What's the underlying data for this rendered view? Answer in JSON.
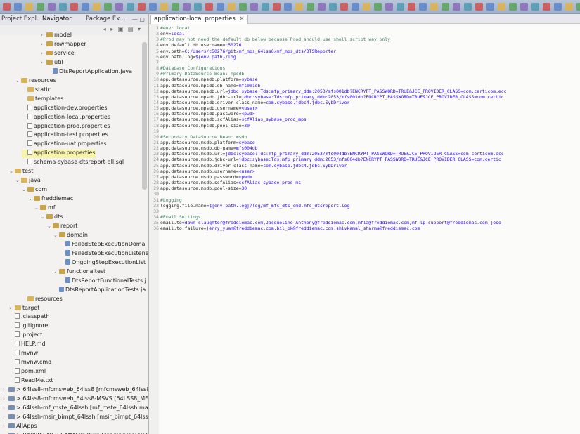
{
  "left_view": {
    "tabs": [
      "Project Expl...",
      "Navigator",
      "Package Ex..."
    ],
    "tree": [
      {
        "label": "model",
        "indent": 6,
        "kind": "pkg",
        "twisty": ">",
        "selected": false
      },
      {
        "label": "rowmapper",
        "indent": 6,
        "kind": "pkg",
        "twisty": ">",
        "selected": false
      },
      {
        "label": "service",
        "indent": 6,
        "kind": "pkg",
        "twisty": ">",
        "selected": false
      },
      {
        "label": "util",
        "indent": 6,
        "kind": "pkg",
        "twisty": ">",
        "selected": false
      },
      {
        "label": "DtsReportApplication.java",
        "indent": 7,
        "kind": "java",
        "twisty": "",
        "selected": false
      },
      {
        "label": "resources",
        "indent": 2,
        "kind": "folder",
        "twisty": "v",
        "selected": false
      },
      {
        "label": "static",
        "indent": 3,
        "kind": "folder",
        "twisty": "",
        "selected": false
      },
      {
        "label": "templates",
        "indent": 3,
        "kind": "folder",
        "twisty": "",
        "selected": false
      },
      {
        "label": "application-dev.properties",
        "indent": 3,
        "kind": "file",
        "twisty": "",
        "selected": false
      },
      {
        "label": "application-local.properties",
        "indent": 3,
        "kind": "file",
        "twisty": "",
        "selected": false
      },
      {
        "label": "application-prod.properties",
        "indent": 3,
        "kind": "file",
        "twisty": "",
        "selected": false
      },
      {
        "label": "application-test.properties",
        "indent": 3,
        "kind": "file",
        "twisty": "",
        "selected": false
      },
      {
        "label": "application-uat.properties",
        "indent": 3,
        "kind": "file",
        "twisty": "",
        "selected": false
      },
      {
        "label": "application.properties",
        "indent": 3,
        "kind": "file",
        "twisty": "",
        "selected": true
      },
      {
        "label": "schema-sybase-dtsreport-all.sql",
        "indent": 3,
        "kind": "file",
        "twisty": "",
        "selected": false
      },
      {
        "label": "test",
        "indent": 1,
        "kind": "folder",
        "twisty": "v",
        "selected": false
      },
      {
        "label": "java",
        "indent": 2,
        "kind": "folder",
        "twisty": "v",
        "selected": false
      },
      {
        "label": "com",
        "indent": 3,
        "kind": "pkg",
        "twisty": "v",
        "selected": false
      },
      {
        "label": "freddiemac",
        "indent": 4,
        "kind": "pkg",
        "twisty": "v",
        "selected": false
      },
      {
        "label": "mf",
        "indent": 5,
        "kind": "pkg",
        "twisty": "v",
        "selected": false
      },
      {
        "label": "dts",
        "indent": 6,
        "kind": "pkg",
        "twisty": "v",
        "selected": false
      },
      {
        "label": "report",
        "indent": 7,
        "kind": "pkg",
        "twisty": "v",
        "selected": false
      },
      {
        "label": "domain",
        "indent": 8,
        "kind": "pkg",
        "twisty": "v",
        "selected": false
      },
      {
        "label": "FailedStepExecutionDoma",
        "indent": 9,
        "kind": "java",
        "twisty": "",
        "selected": false
      },
      {
        "label": "FailedStepExecutionListene",
        "indent": 9,
        "kind": "java",
        "twisty": "",
        "selected": false
      },
      {
        "label": "OngoingStepExecutionList",
        "indent": 9,
        "kind": "java",
        "twisty": "",
        "selected": false
      },
      {
        "label": "functionaltest",
        "indent": 8,
        "kind": "pkg",
        "twisty": "v",
        "selected": false
      },
      {
        "label": "DtsReportFunctionalTests.j",
        "indent": 9,
        "kind": "java",
        "twisty": "",
        "selected": false
      },
      {
        "label": "DtsReportApplicationTests.ja",
        "indent": 8,
        "kind": "java",
        "twisty": "",
        "selected": false
      },
      {
        "label": "resources",
        "indent": 3,
        "kind": "folder",
        "twisty": "",
        "selected": false
      },
      {
        "label": "target",
        "indent": 1,
        "kind": "folder",
        "twisty": ">",
        "selected": false
      },
      {
        "label": ".classpath",
        "indent": 1,
        "kind": "file",
        "twisty": "",
        "selected": false
      },
      {
        "label": ".gitignore",
        "indent": 1,
        "kind": "file",
        "twisty": "",
        "selected": false
      },
      {
        "label": ".project",
        "indent": 1,
        "kind": "file",
        "twisty": "",
        "selected": false
      },
      {
        "label": "HELP.md",
        "indent": 1,
        "kind": "file",
        "twisty": "",
        "selected": false
      },
      {
        "label": "mvnw",
        "indent": 1,
        "kind": "file",
        "twisty": "",
        "selected": false
      },
      {
        "label": "mvnw.cmd",
        "indent": 1,
        "kind": "file",
        "twisty": "",
        "selected": false
      },
      {
        "label": "pom.xml",
        "indent": 1,
        "kind": "file",
        "twisty": "",
        "selected": false
      },
      {
        "label": "ReadMe.txt",
        "indent": 1,
        "kind": "file",
        "twisty": "",
        "selected": false
      },
      {
        "label": "> 64lss8-mfcmsweb_64lss8  [mfcmsweb_64lss8 m",
        "indent": 0,
        "kind": "proj",
        "twisty": ">",
        "selected": false
      },
      {
        "label": "> 64lss8-mfcmsweb_64lss8-MSVS  [64LSS8_MF-N",
        "indent": 0,
        "kind": "proj",
        "twisty": ">",
        "selected": false
      },
      {
        "label": "> 64lssh-mf_mste_64lssh  [mf_mste_64lssh master",
        "indent": 0,
        "kind": "proj",
        "twisty": ">",
        "selected": false
      },
      {
        "label": "> 64lssh-msir_bimpt_64lssh  [msir_bimpt_64lssh n",
        "indent": 0,
        "kind": "proj",
        "twisty": ">",
        "selected": false
      },
      {
        "label": "AllApps",
        "indent": 0,
        "kind": "proj",
        "twisty": ">",
        "selected": false
      },
      {
        "label": "> BA0082-MS02_MMAPs-RuralMappingTool  [BAC",
        "indent": 0,
        "kind": "proj",
        "twisty": ">",
        "selected": false
      }
    ]
  },
  "editor": {
    "tab_label": "application-local.properties",
    "lines": [
      {
        "num": "1",
        "text": "#env: local",
        "kind": "comment"
      },
      {
        "num": "2",
        "text": "env=local",
        "kind": "prop"
      },
      {
        "num": "3",
        "text": "#Prod may not need the default db below because Prod should use shell script way only",
        "kind": "comment"
      },
      {
        "num": "4",
        "text": "env.default.db.username=c50276",
        "kind": "prop"
      },
      {
        "num": "5",
        "text": "env.path=C:/Users/c50276/git/mf_mps_64lss6/mf_mps_dts/DTSReporter",
        "kind": "prop"
      },
      {
        "num": "6",
        "text": "env.path.log=${env.path}/log",
        "kind": "prop"
      },
      {
        "num": "7",
        "text": "",
        "kind": "blank"
      },
      {
        "num": "8",
        "text": "#Database Configurations",
        "kind": "comment"
      },
      {
        "num": "9",
        "text": "#Primary DataSource Bean: mpsdb",
        "kind": "comment"
      },
      {
        "num": "10",
        "text": "app.datasource.mpsdb.platform=sybase",
        "kind": "prop"
      },
      {
        "num": "11",
        "text": "app.datasource.mpsdb.db-name=mfs001db",
        "kind": "prop"
      },
      {
        "num": "12",
        "text": "app.datasource.mpsdb.url=jdbc:sybase:Tds:mfp_primary_ddm:2053/mfs001db?ENCRYPT_PASSWORD=TRUE&JCE_PROVIDER_CLASS=com.certicom.ecc",
        "kind": "prop"
      },
      {
        "num": "13",
        "text": "app.datasource.mpsdb.jdbc-url=jdbc:sybase:Tds:mfp_primary_ddm:2053/mfs001db?ENCRYPT_PASSWORD=TRUE&JCE_PROVIDER_CLASS=com.certic",
        "kind": "prop"
      },
      {
        "num": "14",
        "text": "app.datasource.mpsdb.driver-class-name=com.sybase.jdbc4.jdbc.SybDriver",
        "kind": "prop"
      },
      {
        "num": "15",
        "text": "app.datasource.mpsdb.username=<user>",
        "kind": "prop"
      },
      {
        "num": "16",
        "text": "app.datasource.mpsdb.password=<pwd>",
        "kind": "prop"
      },
      {
        "num": "17",
        "text": "app.datasource.mpsdb.scfAlias=scfAlias_sybase_prod_mps",
        "kind": "prop"
      },
      {
        "num": "18",
        "text": "app.datasource.mpsdb.pool-size=30",
        "kind": "prop"
      },
      {
        "num": "19",
        "text": "",
        "kind": "blank"
      },
      {
        "num": "20",
        "text": "#Secondary DataSource Bean: msdb",
        "kind": "comment"
      },
      {
        "num": "21",
        "text": "app.datasource.msdb.platform=sybase",
        "kind": "prop"
      },
      {
        "num": "22",
        "text": "app.datasource.msdb.db-name=mfs004db",
        "kind": "prop"
      },
      {
        "num": "23",
        "text": "app.datasource.msdb.url=jdbc:sybase:Tds:mfp_primary_ddm:2053/mfs004db?ENCRYPT_PASSWORD=TRUE&JCE_PROVIDER_CLASS=com.certicom.ecc",
        "kind": "prop"
      },
      {
        "num": "24",
        "text": "app.datasource.msdb.jdbc-url=jdbc:sybase:Tds:mfp_primary_ddm:2053/mfs004db?ENCRYPT_PASSWORD=TRUE&JCE_PROVIDER_CLASS=com.certic",
        "kind": "prop"
      },
      {
        "num": "25",
        "text": "app.datasource.msdb.driver-class-name=com.sybase.jdbc4.jdbc.SybDriver",
        "kind": "prop"
      },
      {
        "num": "26",
        "text": "app.datasource.msdb.username=<user>",
        "kind": "prop"
      },
      {
        "num": "27",
        "text": "app.datasource.msdb.password=<pwd>",
        "kind": "prop"
      },
      {
        "num": "28",
        "text": "app.datasource.msdb.scfAlias=scfAlias_sybase_prod_ms",
        "kind": "prop"
      },
      {
        "num": "29",
        "text": "app.datasource.msdb.pool-size=30",
        "kind": "prop"
      },
      {
        "num": "30",
        "text": "",
        "kind": "blank"
      },
      {
        "num": "31",
        "text": "#Logging",
        "kind": "comment"
      },
      {
        "num": "32",
        "text": "logging.file.name=${env.path.log}/log/mf_mfs_dts_cmd.mfs_dtsreport.log",
        "kind": "prop"
      },
      {
        "num": "33",
        "text": "",
        "kind": "blank"
      },
      {
        "num": "34",
        "text": "#Email Settings",
        "kind": "comment"
      },
      {
        "num": "35",
        "text": "email.to=dawn_slaughter@freddiemac.com,Jacqueline_Anthony@freddiemac.com,mfla@freddiemac.com,mf_lp_support@freddiemac.com,jose_",
        "kind": "prop"
      },
      {
        "num": "36",
        "text": "email.to.failure=jerry_yuan@freddiemac.com,bil_bk@freddiemac.com,shivkamal_sharma@freddiemac.com",
        "kind": "prop"
      }
    ]
  },
  "colors": {
    "comment": "#3f7f5f",
    "value": "#2a00ff",
    "selection": "#f7f3a8",
    "toolbar": "#a9b8cd"
  }
}
